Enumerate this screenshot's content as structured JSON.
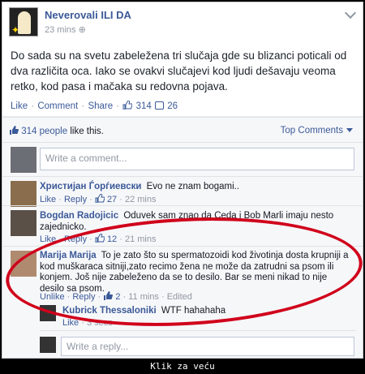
{
  "post": {
    "page_name": "Neverovali ILI DA",
    "time": "23 mins",
    "text": "Do sada su na svetu zabeležena tri slučaja gde su blizanci poticali od dva različita oca. Iako se ovakvi slučajevi kod ljudi dešavaju veoma retko, kod pasa i mačaka su redovna pojava.",
    "actions": {
      "like": "Like",
      "comment": "Comment",
      "share": "Share",
      "like_count": "314",
      "comment_count": "26",
      "sep": "·"
    }
  },
  "ufi": {
    "likes_count": "314 people",
    "likes_suffix": "like this.",
    "top_comments": "Top Comments",
    "write_placeholder": "Write a comment...",
    "reply_placeholder": "Write a reply..."
  },
  "comments": [
    {
      "name": "Христијан Ѓорѓиевски",
      "text": "Evo ne znam bogami..",
      "like": "Like",
      "reply": "Reply",
      "likes": "27",
      "time": "22 mins"
    },
    {
      "name": "Bogdan Radojicic",
      "text": "Oduvek sam znao da Ceda i Bob Marli imaju nesto zajednicko.",
      "like": "Like",
      "reply": "Reply",
      "likes": "12",
      "time": "21 mins"
    },
    {
      "name": "Marija Marija",
      "text": "To je zato što su spermatozoidi kod životinja dosta krupniji a kod muškaraca sitniji,zato recimo žena ne može da zatrudni sa psom ili konjem. Još nije zabeleženo da se to desilo. Bar se meni nikad to nije desilo sa psom.",
      "unlike": "Unlike",
      "reply": "Reply",
      "likes": "2",
      "time": "11 mins",
      "edited": "Edited"
    }
  ],
  "reply": {
    "name": "Kubrick Thessaloniki",
    "text": "WTF hahahaha",
    "like": "Like",
    "time": "3 secs"
  },
  "caption": "Klik za veću",
  "colors": {
    "link": "#3b5998",
    "oval": "#d0021b"
  }
}
